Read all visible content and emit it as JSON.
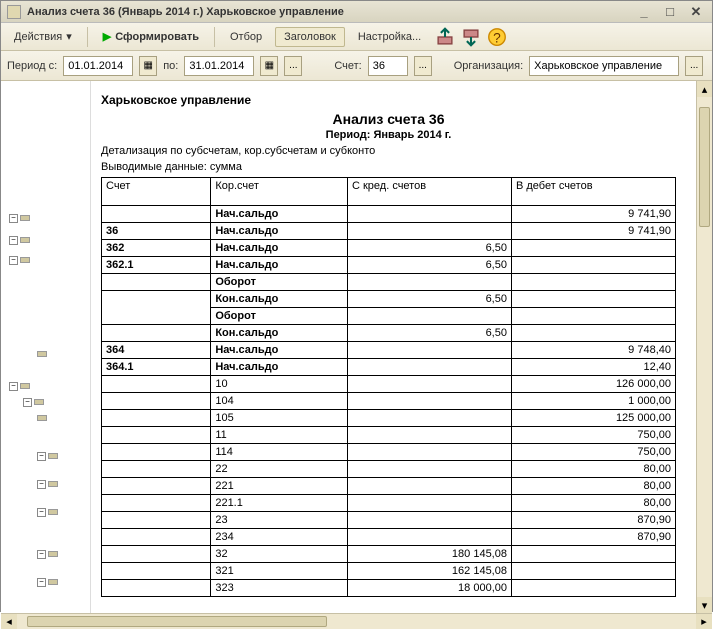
{
  "window": {
    "title": "Анализ счета 36 (Январь 2014 г.) Харьковское управление"
  },
  "toolbar": {
    "actions": "Действия",
    "generate": "Сформировать",
    "filter": "Отбор",
    "header": "Заголовок",
    "settings": "Настройка..."
  },
  "params": {
    "period_from_label": "Период с:",
    "period_from": "01.01.2014",
    "period_to_label": "по:",
    "period_to": "31.01.2014",
    "account_label": "Счет:",
    "account": "36",
    "org_label": "Организация:",
    "org": "Харьковское управление"
  },
  "report": {
    "org_name": "Харьковское управление",
    "title": "Анализ счета 36",
    "period": "Период: Январь 2014 г.",
    "detail": "Детализация по  субсчетам, кор.субсчетам и субконто",
    "output": "Выводимые данные: сумма",
    "cols": {
      "c1": "Счет",
      "c2": "Кор.счет",
      "c3": "С кред. счетов",
      "c4": "В дебет счетов"
    },
    "labels": {
      "opening": "Нач.сальдо",
      "turnover": "Оборот",
      "closing": "Кон.сальдо"
    },
    "rows": [
      {
        "a": "",
        "k": "Нач.сальдо",
        "c": "",
        "d": "9 741,90",
        "b": true
      },
      {
        "a": "36",
        "k": "Нач.сальдо",
        "c": "",
        "d": "9 741,90",
        "b": true
      },
      {
        "a": "362",
        "k": "Нач.сальдо",
        "c": "6,50",
        "d": "",
        "b": true
      },
      {
        "a": "362.1",
        "k": "Нач.сальдо",
        "c": "6,50",
        "d": "",
        "b": true
      },
      {
        "a": "",
        "k": "Оборот",
        "c": "",
        "d": "",
        "b": true,
        "nt": true
      },
      {
        "a": "",
        "k": "Кон.сальдо",
        "c": "6,50",
        "d": "",
        "b": true,
        "nb": true
      },
      {
        "a": "",
        "k": "Оборот",
        "c": "",
        "d": "",
        "b": true,
        "nt": true
      },
      {
        "a": "",
        "k": "Кон.сальдо",
        "c": "6,50",
        "d": "",
        "b": true,
        "nb": true
      },
      {
        "a": "364",
        "k": "Нач.сальдо",
        "c": "",
        "d": "9 748,40",
        "b": true
      },
      {
        "a": "364.1",
        "k": "Нач.сальдо",
        "c": "",
        "d": "12,40",
        "b": true
      },
      {
        "a": "",
        "k": "10",
        "c": "",
        "d": "126 000,00"
      },
      {
        "a": "",
        "k": "104",
        "c": "",
        "d": "1 000,00"
      },
      {
        "a": "",
        "k": "105",
        "c": "",
        "d": "125 000,00"
      },
      {
        "a": "",
        "k": "11",
        "c": "",
        "d": "750,00"
      },
      {
        "a": "",
        "k": "114",
        "c": "",
        "d": "750,00"
      },
      {
        "a": "",
        "k": "22",
        "c": "",
        "d": "80,00"
      },
      {
        "a": "",
        "k": "221",
        "c": "",
        "d": "80,00"
      },
      {
        "a": "",
        "k": "221.1",
        "c": "",
        "d": "80,00"
      },
      {
        "a": "",
        "k": "23",
        "c": "",
        "d": "870,90"
      },
      {
        "a": "",
        "k": "234",
        "c": "",
        "d": "870,90"
      },
      {
        "a": "",
        "k": "32",
        "c": "180 145,08",
        "d": ""
      },
      {
        "a": "",
        "k": "321",
        "c": "162 145,08",
        "d": ""
      },
      {
        "a": "",
        "k": "323",
        "c": "18 000,00",
        "d": ""
      }
    ]
  }
}
